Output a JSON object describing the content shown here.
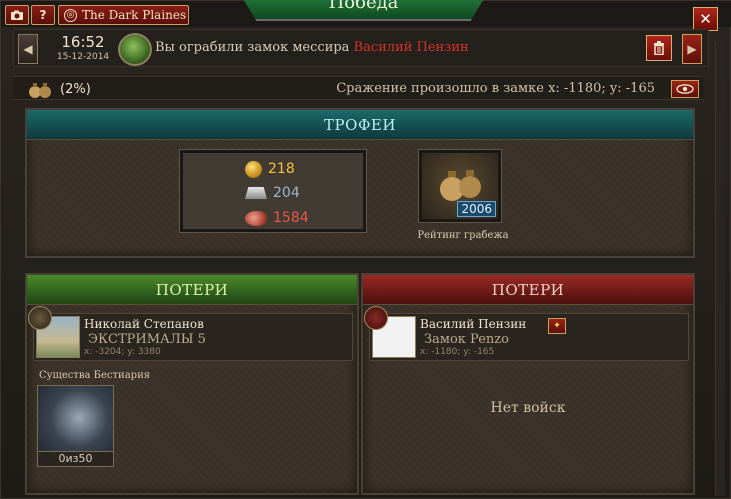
{
  "topbar": {
    "camera_icon": "camera-icon",
    "help_label": "?",
    "realm_name": "The Dark Plaines",
    "title": "Победа",
    "close_label": "✕"
  },
  "message": {
    "time": "16:52",
    "date": "15-12-2014",
    "text": "Вы ограбили замок мессира ",
    "target_name": "Василий Пензин"
  },
  "info": {
    "percent": "(2%)",
    "location": "Сражение произошло в замке x: -1180; y: -165"
  },
  "trophies": {
    "header": "ТРОФЕИ",
    "gold": "218",
    "iron": "204",
    "meat": "1584",
    "rating_value": "2006",
    "rating_label": "Рейтинг грабежа"
  },
  "losses_left": {
    "header": "ПОТЕРИ",
    "player_name": "Николай Степанов",
    "player_sub": "ЭКСТРИМАЛЫ 5",
    "player_coords": "x: -3204; y: 3380",
    "bestiary_label": "Существа Бестиария",
    "bestiary_count": "0из50"
  },
  "losses_right": {
    "header": "ПОТЕРИ",
    "player_name": "Василий Пензин",
    "player_sub": "Замок Penzo",
    "player_coords": "x: -1180; y: -165",
    "no_troops": "Нет войск"
  },
  "colors": {
    "accent_red": "#d8322a",
    "teal_header": "#1d6a6a",
    "green_header": "#4a8a2a",
    "red_header": "#9a2a24",
    "gold_text": "#f2c23a",
    "iron_text": "#9fb6c8",
    "meat_text": "#e8564a"
  }
}
